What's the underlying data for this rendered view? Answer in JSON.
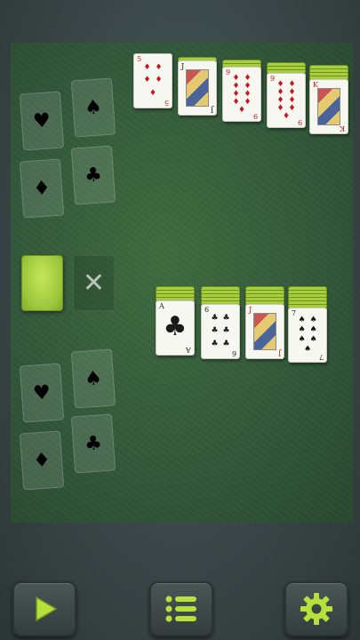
{
  "game": "Solitaire",
  "colors": {
    "felt": "#32583a",
    "card_back": "#9bc53a",
    "accent": "#b6e03c",
    "red_suit": "#c8161d",
    "black_suit": "#1a1a1a"
  },
  "top_row": [
    {
      "rank": "5",
      "suit": "♦",
      "color": "red",
      "backs": 0
    },
    {
      "rank": "J",
      "suit": "♣",
      "color": "black",
      "backs": 1
    },
    {
      "rank": "9",
      "suit": "♦",
      "color": "red",
      "backs": 2
    },
    {
      "rank": "9",
      "suit": "♦",
      "color": "red",
      "backs": 3
    },
    {
      "rank": "K",
      "suit": "♦",
      "color": "red",
      "backs": 4
    }
  ],
  "tableau": [
    {
      "rank": "A",
      "suit": "♣",
      "color": "black",
      "backs": 4
    },
    {
      "rank": "6",
      "suit": "♣",
      "color": "black",
      "backs": 5
    },
    {
      "rank": "J",
      "suit": "♥",
      "color": "red",
      "backs": 5
    },
    {
      "rank": "7",
      "suit": "♠",
      "color": "black",
      "backs": 6
    }
  ],
  "foundations_top": [
    {
      "suit": "♥",
      "tone": "red-suit"
    },
    {
      "suit": "♠",
      "tone": "dark-suit"
    },
    {
      "suit": "♦",
      "tone": "red-suit"
    },
    {
      "suit": "♣",
      "tone": "dark-suit"
    }
  ],
  "foundations_bottom": [
    {
      "suit": "♥",
      "tone": "red-suit"
    },
    {
      "suit": "♠",
      "tone": "dark-suit"
    },
    {
      "suit": "♦",
      "tone": "red-suit"
    },
    {
      "suit": "♣",
      "tone": "dark-suit"
    }
  ],
  "waste_symbol": "✕",
  "toolbar": {
    "play_icon": "play-icon",
    "menu_icon": "menu-icon",
    "settings_icon": "gear-icon"
  }
}
